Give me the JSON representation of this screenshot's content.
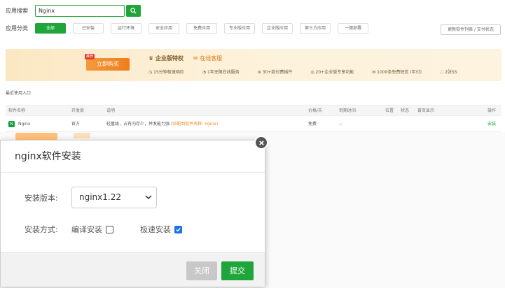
{
  "search": {
    "label": "应用搜索",
    "value": "Nginx"
  },
  "categories": {
    "label": "应用分类",
    "items": [
      "全部",
      "已安装",
      "运行环境",
      "安全应用",
      "免费应用",
      "专业版应用",
      "企业版应用",
      "第三方应用",
      "一键部署"
    ],
    "update_label": "更新软件列表 / 支付状态"
  },
  "banner": {
    "buy_label": "立即购买",
    "buy_tag": "推荐",
    "enterprise_title": "企业版特权",
    "support_title": "在线客服",
    "privileges": [
      "15分钟极速响应",
      "1年无限在线服务",
      "30+款付费插件",
      "20+企业版专享功能",
      "1000条免费短信 (年付)",
      "2张SS"
    ]
  },
  "recent_label": "最近使用入口",
  "table": {
    "headers": [
      "软件名称",
      "开发商",
      "说明",
      "价格/天",
      "到期时间",
      "位置",
      "状态",
      "首页显示",
      "操作"
    ],
    "row": {
      "name": "Nginx",
      "vendor": "官方",
      "desc": "轻量级，占有内存少，并发能力强",
      "desc_note": "(匹配到软件名称: nginx)",
      "price": "免费",
      "expire": "--",
      "action": "安装"
    }
  },
  "modal": {
    "title": "nginx软件安装",
    "version_label": "安装版本:",
    "version_value": "nginx1.22",
    "method_label": "安装方式:",
    "compile_label": "编译安装",
    "fast_label": "极速安装",
    "compile_checked": false,
    "fast_checked": true,
    "close_label": "关闭",
    "submit_label": "提交"
  },
  "colors": {
    "accent": "#20a53a",
    "checkbox": "#1a73e8",
    "banner_orange": "#ef7e1d"
  }
}
